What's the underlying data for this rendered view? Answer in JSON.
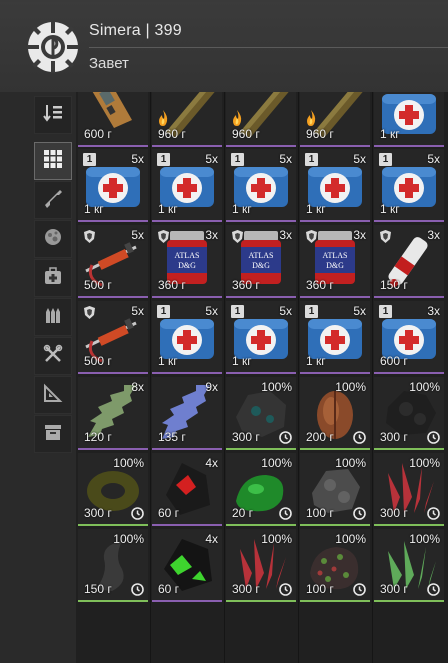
{
  "header": {
    "player": "Simera | 399",
    "faction": "Завет"
  },
  "sidebar": [
    {
      "icon": "sort-icon",
      "active": false
    },
    {
      "icon": "grid-icon",
      "active": true
    },
    {
      "icon": "weapon-icon",
      "active": false
    },
    {
      "icon": "artifact-icon",
      "active": false
    },
    {
      "icon": "medkit-icon",
      "active": false
    },
    {
      "icon": "ammo-icon",
      "active": false
    },
    {
      "icon": "tools-icon",
      "active": false
    },
    {
      "icon": "blueprint-icon",
      "active": false
    },
    {
      "icon": "storage-box-icon",
      "active": false
    }
  ],
  "rows": [
    [
      {
        "art": "device",
        "price": "600 г",
        "qty": "",
        "badge": "",
        "shield": false,
        "clock": false,
        "flame": false,
        "edge": "rare"
      },
      {
        "art": "bar",
        "price": "960 г",
        "qty": "",
        "badge": "",
        "shield": false,
        "clock": false,
        "flame": true,
        "edge": "rare"
      },
      {
        "art": "bar",
        "price": "960 г",
        "qty": "",
        "badge": "",
        "shield": false,
        "clock": false,
        "flame": true,
        "edge": "rare"
      },
      {
        "art": "bar",
        "price": "960 г",
        "qty": "",
        "badge": "",
        "shield": false,
        "clock": false,
        "flame": true,
        "edge": "rare"
      },
      {
        "art": "medkit",
        "price": "1 кг",
        "qty": "",
        "badge": "",
        "shield": false,
        "clock": false,
        "flame": false,
        "edge": "rare"
      }
    ],
    [
      {
        "art": "medkit",
        "price": "1 кг",
        "qty": "5x",
        "badge": "1",
        "shield": false,
        "clock": false,
        "flame": false,
        "edge": "rare"
      },
      {
        "art": "medkit",
        "price": "1 кг",
        "qty": "5x",
        "badge": "1",
        "shield": false,
        "clock": false,
        "flame": false,
        "edge": "rare"
      },
      {
        "art": "medkit",
        "price": "1 кг",
        "qty": "5x",
        "badge": "1",
        "shield": false,
        "clock": false,
        "flame": false,
        "edge": "rare"
      },
      {
        "art": "medkit",
        "price": "1 кг",
        "qty": "5x",
        "badge": "1",
        "shield": false,
        "clock": false,
        "flame": false,
        "edge": "rare"
      },
      {
        "art": "medkit",
        "price": "1 кг",
        "qty": "5x",
        "badge": "1",
        "shield": false,
        "clock": false,
        "flame": false,
        "edge": "rare"
      }
    ],
    [
      {
        "art": "syringe",
        "price": "500 г",
        "qty": "5x",
        "badge": "",
        "shield": true,
        "clock": false,
        "flame": false,
        "edge": "rare"
      },
      {
        "art": "jar",
        "price": "360 г",
        "qty": "3x",
        "badge": "",
        "shield": true,
        "clock": false,
        "flame": false,
        "edge": "rare"
      },
      {
        "art": "jar",
        "price": "360 г",
        "qty": "3x",
        "badge": "",
        "shield": true,
        "clock": false,
        "flame": false,
        "edge": "rare"
      },
      {
        "art": "jar",
        "price": "360 г",
        "qty": "3x",
        "badge": "",
        "shield": true,
        "clock": false,
        "flame": false,
        "edge": "rare"
      },
      {
        "art": "tube",
        "price": "150 г",
        "qty": "3x",
        "badge": "",
        "shield": true,
        "clock": false,
        "flame": false,
        "edge": "rare"
      }
    ],
    [
      {
        "art": "syringe",
        "price": "500 г",
        "qty": "5x",
        "badge": "",
        "shield": true,
        "clock": false,
        "flame": false,
        "edge": "rare"
      },
      {
        "art": "medkit",
        "price": "1 кг",
        "qty": "5x",
        "badge": "1",
        "shield": false,
        "clock": false,
        "flame": false,
        "edge": "rare"
      },
      {
        "art": "medkit",
        "price": "1 кг",
        "qty": "5x",
        "badge": "1",
        "shield": false,
        "clock": false,
        "flame": false,
        "edge": "rare"
      },
      {
        "art": "medkit",
        "price": "1 кг",
        "qty": "5x",
        "badge": "1",
        "shield": false,
        "clock": false,
        "flame": false,
        "edge": "rare"
      },
      {
        "art": "medkit",
        "price": "600 г",
        "qty": "3x",
        "badge": "1",
        "shield": false,
        "clock": false,
        "flame": false,
        "edge": "rare"
      }
    ],
    [
      {
        "art": "spiky-green",
        "price": "120 г",
        "qty": "8x",
        "badge": "",
        "shield": false,
        "clock": false,
        "flame": false,
        "edge": "rare"
      },
      {
        "art": "spiky-blue",
        "price": "135 г",
        "qty": "9x",
        "badge": "",
        "shield": false,
        "clock": false,
        "flame": false,
        "edge": "rare"
      },
      {
        "art": "rock-dark",
        "price": "300 г",
        "qty": "100%",
        "badge": "",
        "shield": false,
        "clock": true,
        "flame": false,
        "edge": "green"
      },
      {
        "art": "pod",
        "price": "200 г",
        "qty": "100%",
        "badge": "",
        "shield": false,
        "clock": true,
        "flame": false,
        "edge": "green"
      },
      {
        "art": "rock-black",
        "price": "300 г",
        "qty": "100%",
        "badge": "",
        "shield": false,
        "clock": true,
        "flame": false,
        "edge": "green"
      }
    ],
    [
      {
        "art": "ring",
        "price": "300 г",
        "qty": "100%",
        "badge": "",
        "shield": false,
        "clock": true,
        "flame": false,
        "edge": "green"
      },
      {
        "art": "crystal-red",
        "price": "60 г",
        "qty": "4x",
        "badge": "",
        "shield": false,
        "clock": false,
        "flame": false,
        "edge": "rare"
      },
      {
        "art": "blob-green",
        "price": "20 г",
        "qty": "100%",
        "badge": "",
        "shield": false,
        "clock": true,
        "flame": false,
        "edge": "green"
      },
      {
        "art": "rock-grey",
        "price": "100 г",
        "qty": "100%",
        "badge": "",
        "shield": false,
        "clock": true,
        "flame": false,
        "edge": "green"
      },
      {
        "art": "coral-red",
        "price": "300 г",
        "qty": "100%",
        "badge": "",
        "shield": false,
        "clock": true,
        "flame": false,
        "edge": "green"
      }
    ],
    [
      {
        "art": "twist",
        "price": "150 г",
        "qty": "100%",
        "badge": "",
        "shield": false,
        "clock": true,
        "flame": false,
        "edge": "green"
      },
      {
        "art": "crystal-green",
        "price": "60 г",
        "qty": "4x",
        "badge": "",
        "shield": false,
        "clock": false,
        "flame": false,
        "edge": "rare"
      },
      {
        "art": "coral-red",
        "price": "300 г",
        "qty": "100%",
        "badge": "",
        "shield": false,
        "clock": true,
        "flame": false,
        "edge": "green"
      },
      {
        "art": "moss",
        "price": "100 г",
        "qty": "100%",
        "badge": "",
        "shield": false,
        "clock": true,
        "flame": false,
        "edge": "green"
      },
      {
        "art": "coral-green",
        "price": "300 г",
        "qty": "100%",
        "badge": "",
        "shield": false,
        "clock": true,
        "flame": false,
        "edge": "green"
      }
    ]
  ]
}
